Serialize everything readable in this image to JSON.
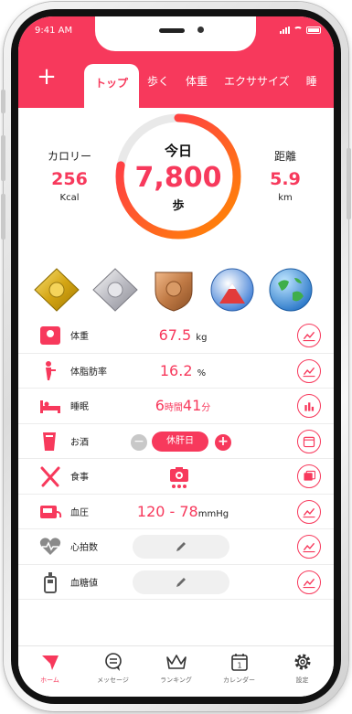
{
  "colors": {
    "accent": "#f7395c",
    "ring_start": "#ff8a00",
    "ring_end": "#ff2d55",
    "ring_bg": "#e9e9e9"
  },
  "status_bar": {
    "time": "9:41 AM"
  },
  "header": {
    "add_icon": "plus-icon",
    "tabs": [
      {
        "label": "トップ",
        "active": true
      },
      {
        "label": "歩く"
      },
      {
        "label": "体重"
      },
      {
        "label": "エクササイズ"
      },
      {
        "label": "睡"
      }
    ]
  },
  "summary": {
    "calories": {
      "label": "カロリー",
      "value": "256",
      "unit": "Kcal"
    },
    "today": {
      "label": "今日",
      "value": "7,800",
      "unit": "歩",
      "progress": 0.78
    },
    "distance": {
      "label": "距離",
      "value": "5.9",
      "unit": "km"
    }
  },
  "badges": [
    {
      "icon": "gold-badge-icon"
    },
    {
      "icon": "silver-badge-icon"
    },
    {
      "icon": "bronze-badge-icon"
    },
    {
      "icon": "mountain-badge-icon"
    },
    {
      "icon": "globe-badge-icon"
    }
  ],
  "metrics": [
    {
      "label": "体重",
      "value": "67.5",
      "unit": "kg",
      "icon": "scale-icon",
      "action_icon": "line-chart-icon"
    },
    {
      "label": "体脂肪率",
      "value": "16.2",
      "unit": "%",
      "icon": "body-fat-icon",
      "action_icon": "line-chart-icon"
    },
    {
      "label": "睡眠",
      "hours": "6",
      "hours_unit": "時間",
      "minutes": "41",
      "minutes_unit": "分",
      "icon": "bed-icon",
      "action_icon": "bar-chart-icon"
    },
    {
      "label": "お酒",
      "rest_label": "休肝日",
      "icon": "glass-icon",
      "action_icon": "calendar-icon"
    },
    {
      "label": "食事",
      "icon": "fork-knife-icon",
      "action_icon": "photos-icon"
    },
    {
      "label": "血圧",
      "value": "120 - 78",
      "unit": "mmHg",
      "icon": "blood-pressure-icon",
      "action_icon": "line-chart-icon"
    },
    {
      "label": "心拍数",
      "icon": "heart-rate-icon",
      "action_icon": "line-chart-icon"
    },
    {
      "label": "血糖値",
      "icon": "glucose-meter-icon",
      "action_icon": "line-chart-icon"
    }
  ],
  "bottom_nav": [
    {
      "label": "ホーム",
      "icon": "home-icon",
      "active": true
    },
    {
      "label": "メッセージ",
      "icon": "message-icon"
    },
    {
      "label": "ランキング",
      "icon": "crown-icon"
    },
    {
      "label": "カレンダー",
      "icon": "calendar-icon",
      "day": "1"
    },
    {
      "label": "設定",
      "icon": "gear-icon"
    }
  ]
}
